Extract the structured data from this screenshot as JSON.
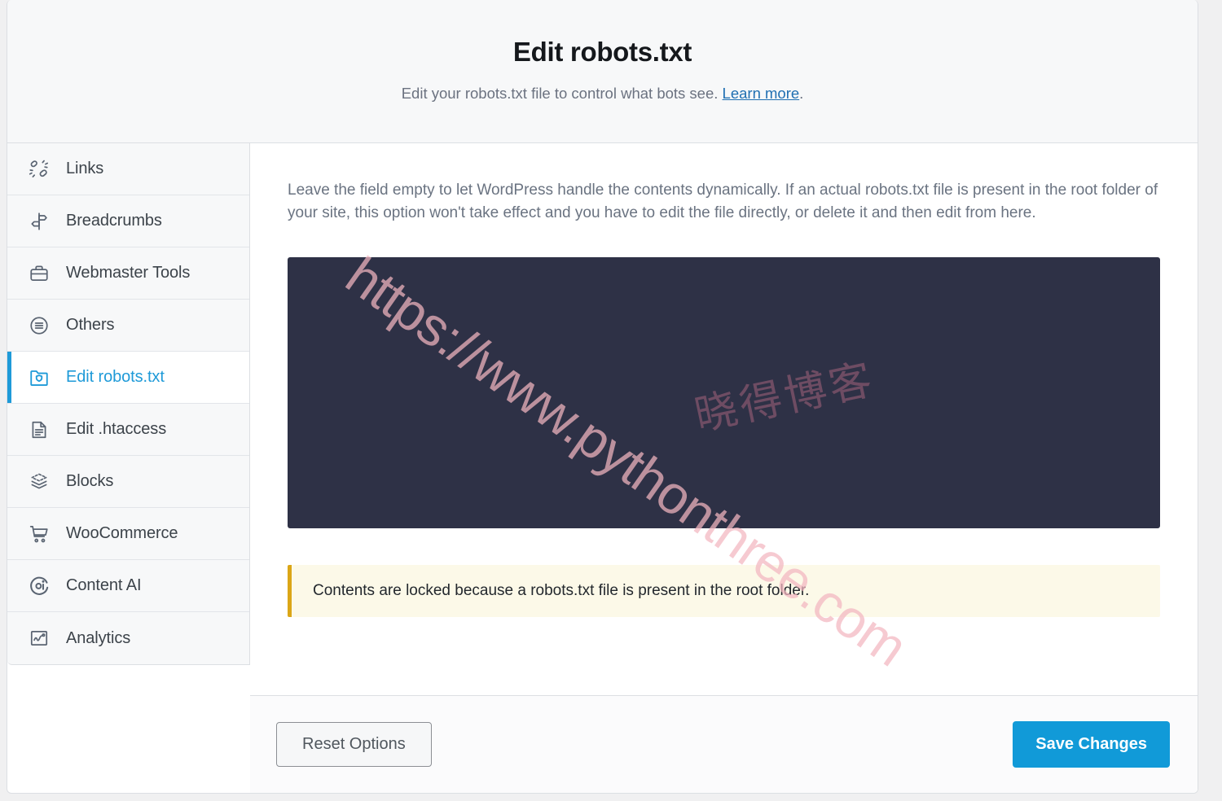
{
  "header": {
    "title": "Edit robots.txt",
    "subtitle_before": "Edit your robots.txt file to control what bots see. ",
    "subtitle_link": "Learn more",
    "subtitle_after": "."
  },
  "sidebar": {
    "items": [
      {
        "label": "Links",
        "icon": "links-icon",
        "active": false
      },
      {
        "label": "Breadcrumbs",
        "icon": "signpost-icon",
        "active": false
      },
      {
        "label": "Webmaster Tools",
        "icon": "briefcase-icon",
        "active": false
      },
      {
        "label": "Others",
        "icon": "list-circle-icon",
        "active": false
      },
      {
        "label": "Edit robots.txt",
        "icon": "folder-shield-icon",
        "active": true
      },
      {
        "label": "Edit .htaccess",
        "icon": "file-lines-icon",
        "active": false
      },
      {
        "label": "Blocks",
        "icon": "layers-icon",
        "active": false
      },
      {
        "label": "WooCommerce",
        "icon": "shopping-cart-icon",
        "active": false
      },
      {
        "label": "Content AI",
        "icon": "content-ai-icon",
        "active": false
      },
      {
        "label": "Analytics",
        "icon": "analytics-chart-icon",
        "active": false
      }
    ]
  },
  "main": {
    "helper_text": "Leave the field empty to let WordPress handle the contents dynamically. If an actual robots.txt file is present in the root folder of your site, this option won't take effect and you have to edit the file directly, or delete it and then edit from here.",
    "editor": {
      "value": "",
      "placeholder": ""
    },
    "notice": {
      "text": "Contents are locked because a robots.txt file is present in the root folder.",
      "accent_color": "#dba617",
      "background_color": "#fcf9e8"
    }
  },
  "footer": {
    "reset_label": "Reset Options",
    "save_label": "Save Changes",
    "primary_color": "#119ad8"
  },
  "watermarks": {
    "url": "https://www.pythonthree.com",
    "chinese": "晓得博客"
  }
}
